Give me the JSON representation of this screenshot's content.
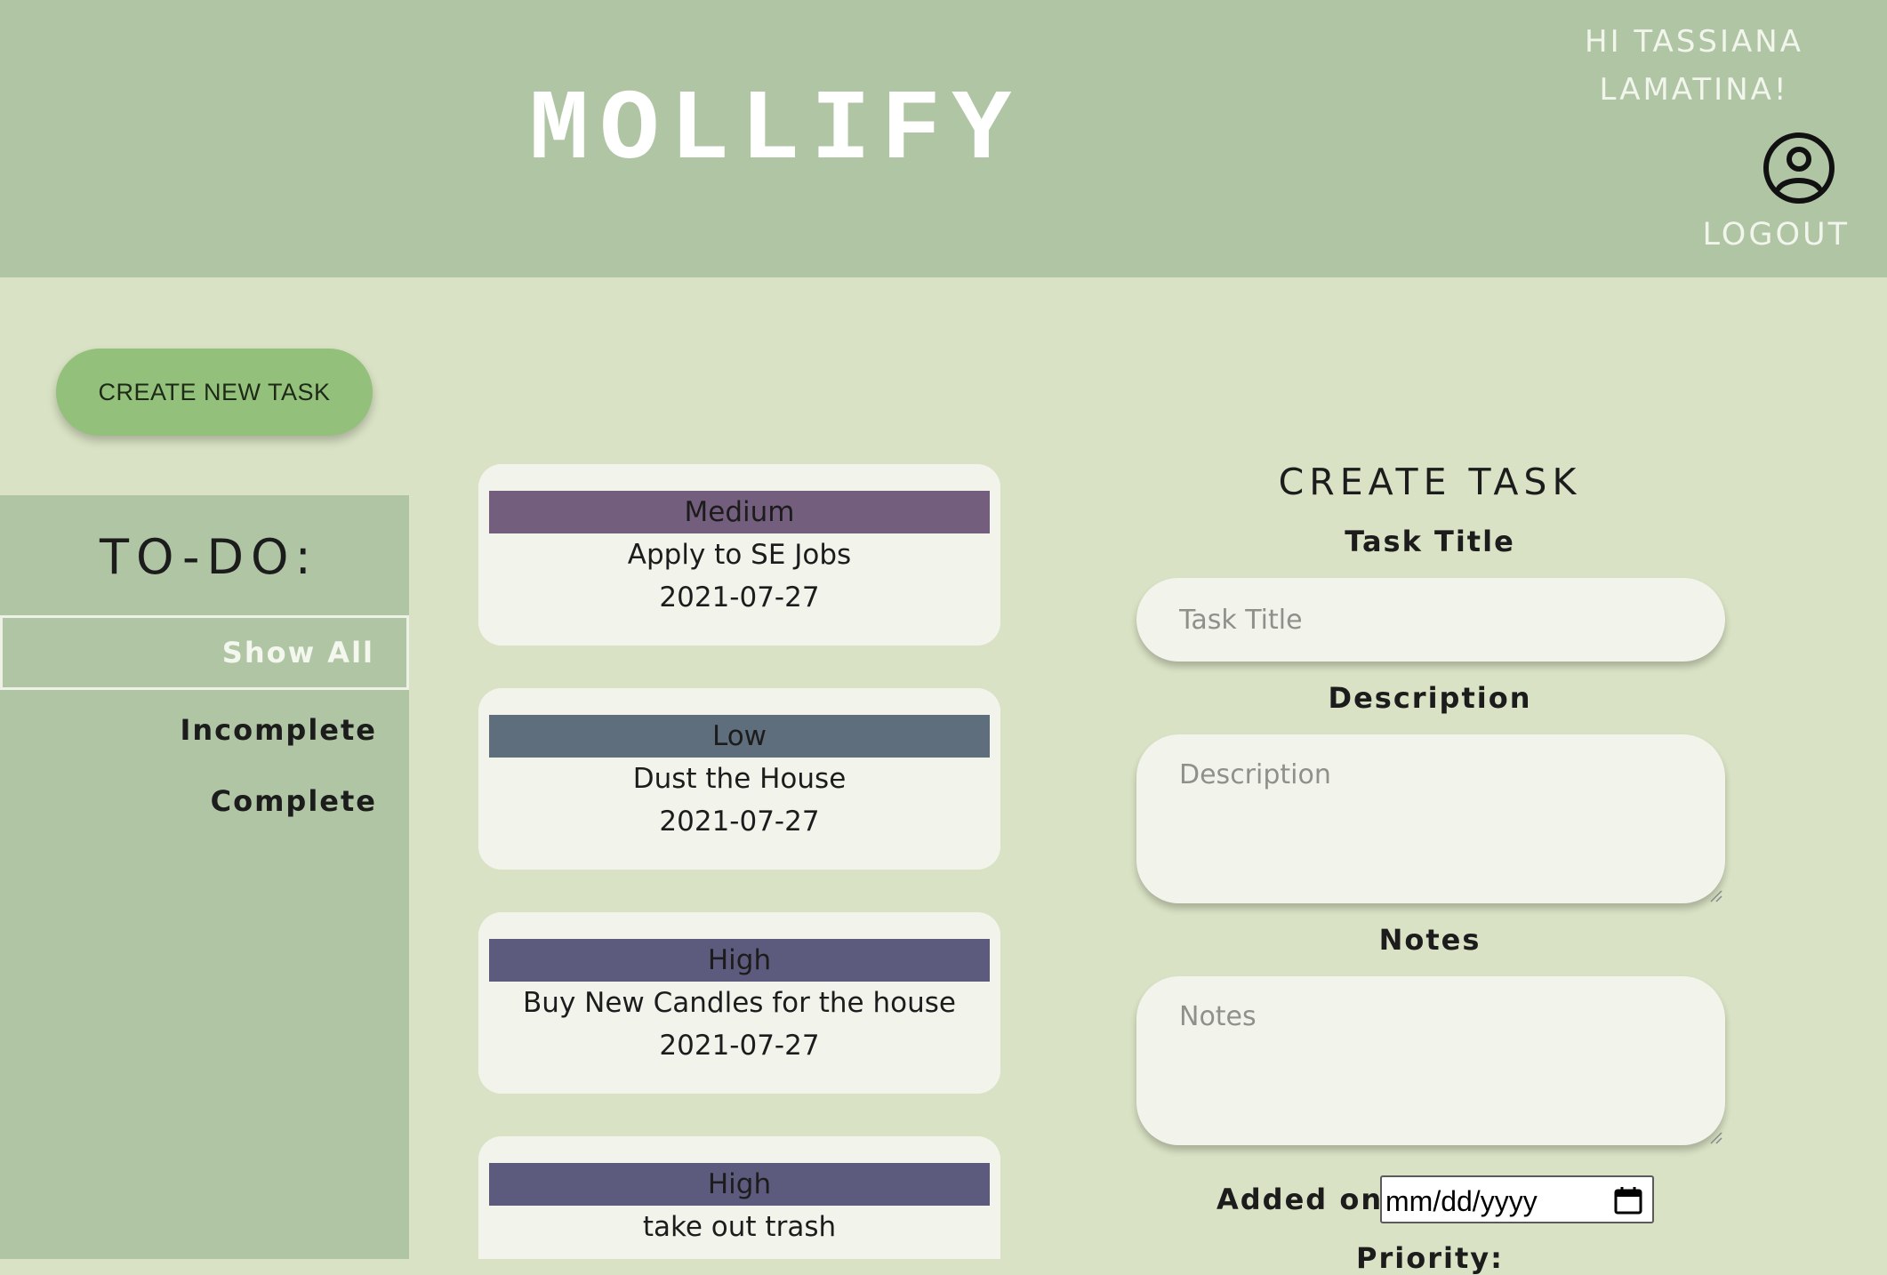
{
  "header": {
    "brand": "MOLLIFY",
    "greeting": "HI TASSIANA LAMATINA!",
    "logout_label": "LOGOUT",
    "user_icon": "user-circle-icon"
  },
  "actions": {
    "create_new_task_label": "CREATE NEW TASK"
  },
  "sidebar": {
    "title": "TO-DO:",
    "filters": [
      {
        "label": "Show All",
        "active": true
      },
      {
        "label": "Incomplete",
        "active": false
      },
      {
        "label": "Complete",
        "active": false
      }
    ]
  },
  "tasks": [
    {
      "priority": "Medium",
      "title": "Apply to SE Jobs",
      "date": "2021-07-27",
      "priority_color": "#745e7d"
    },
    {
      "priority": "Low",
      "title": "Dust the House",
      "date": "2021-07-27",
      "priority_color": "#5f6e7c"
    },
    {
      "priority": "High",
      "title": "Buy New Candles for the house",
      "date": "2021-07-27",
      "priority_color": "#5c5b7e"
    },
    {
      "priority": "High",
      "title": "take out trash",
      "date": "",
      "priority_color": "#5c5b7e"
    }
  ],
  "form": {
    "heading": "CREATE TASK",
    "task_title_label": "Task Title",
    "task_title_placeholder": "Task Title",
    "description_label": "Description",
    "description_placeholder": "Description",
    "notes_label": "Notes",
    "notes_placeholder": "Notes",
    "added_on_label": "Added on:",
    "date_placeholder": "mm/dd/yyyy",
    "priority_label": "Priority:"
  },
  "colors": {
    "header_bg": "#afc5a4",
    "page_bg": "#d9e2c4",
    "button_green": "#93c07a",
    "card_bg": "#f2f4ec"
  }
}
